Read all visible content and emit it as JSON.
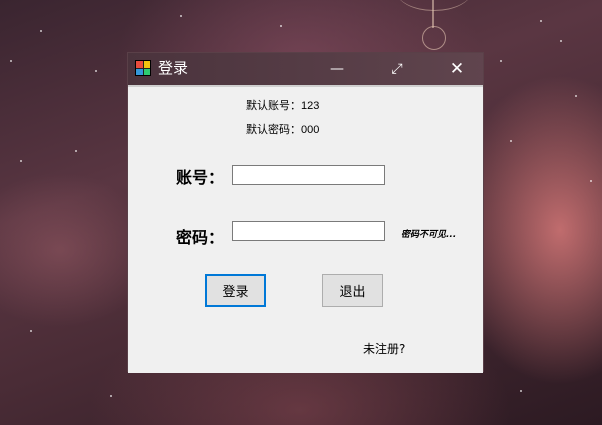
{
  "window": {
    "title": "登录",
    "minimize_symbol": "—",
    "maximize_symbol": "⤢",
    "close_symbol": "✕"
  },
  "hints": {
    "default_account": "默认账号：123",
    "default_password": "默认密码：000"
  },
  "form": {
    "account_label": "账号：",
    "account_value": "",
    "password_label": "密码：",
    "password_value": "",
    "password_note": "密码不可见..."
  },
  "buttons": {
    "login": "登录",
    "exit": "退出"
  },
  "register_link": "未注册?",
  "icons": {
    "app": "app-icon",
    "minimize": "minimize-icon",
    "maximize": "maximize-icon",
    "close": "close-icon"
  },
  "colors": {
    "focus_border": "#0078d7",
    "client_bg": "#f0f0f0"
  }
}
